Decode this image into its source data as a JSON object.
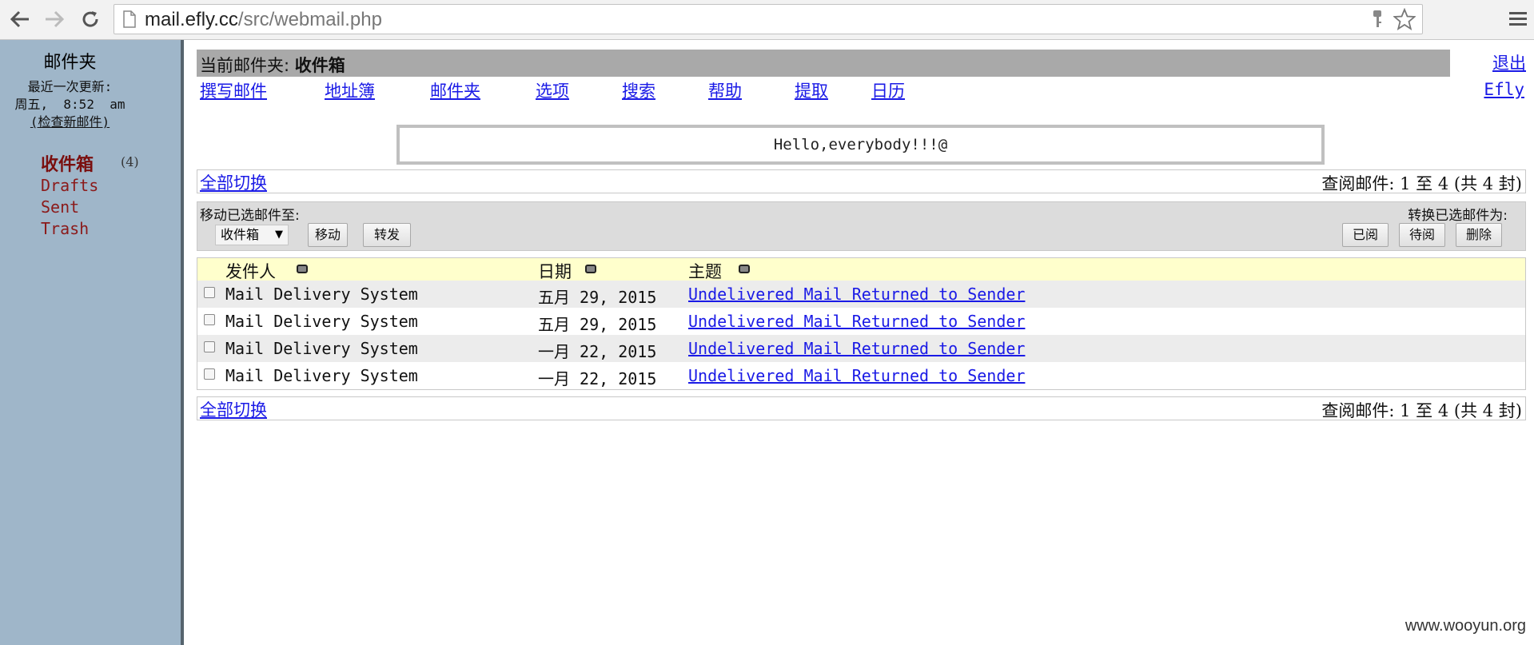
{
  "browser": {
    "url_host": "mail.efly.cc",
    "url_path": "/src/webmail.php"
  },
  "sidebar": {
    "title": "邮件夹",
    "last_update_label": "最近一次更新:",
    "last_update_time": "周五,  8:52  am",
    "check_mail": "(检查新邮件)",
    "folders": [
      {
        "label": "收件箱",
        "count": "(4)"
      },
      {
        "label": "Drafts"
      },
      {
        "label": "Sent"
      },
      {
        "label": "Trash"
      }
    ]
  },
  "header": {
    "current_folder_label": "当前邮件夹:",
    "current_folder": "收件箱",
    "logout": "退出",
    "user": "Efly",
    "menu": [
      "撰写邮件",
      "地址簿",
      "邮件夹",
      "选项",
      "搜索",
      "帮助",
      "提取",
      "日历"
    ]
  },
  "motd": "Hello,everybody!!!@",
  "listing": {
    "toggle_all": "全部切换",
    "range": "查阅邮件: 1 至 4 (共 4 封)",
    "move_label": "移动已选邮件至:",
    "move_select": "收件箱",
    "move_btn": "移动",
    "forward_btn": "转发",
    "mark_label": "转换已选邮件为:",
    "read_btn": "已阅",
    "unread_btn": "待阅",
    "delete_btn": "删除",
    "columns": {
      "from": "发件人",
      "date": "日期",
      "subject": "主题"
    },
    "rows": [
      {
        "from": "Mail Delivery System",
        "date": "五月 29, 2015",
        "subject": "Undelivered Mail Returned to Sender"
      },
      {
        "from": "Mail Delivery System",
        "date": "五月 29, 2015",
        "subject": "Undelivered Mail Returned to Sender"
      },
      {
        "from": "Mail Delivery System",
        "date": "一月 22, 2015",
        "subject": "Undelivered Mail Returned to Sender"
      },
      {
        "from": "Mail Delivery System",
        "date": "一月 22, 2015",
        "subject": "Undelivered Mail Returned to Sender"
      }
    ]
  },
  "watermark": "www.wooyun.org"
}
